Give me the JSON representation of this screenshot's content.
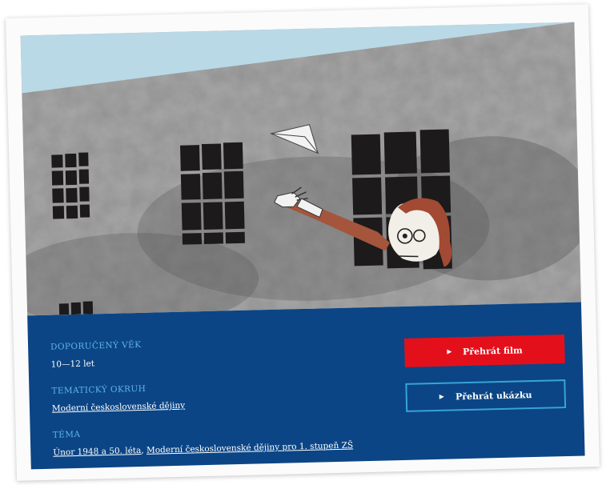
{
  "meta": {
    "age_label": "DOPORUČENÝ VĚK",
    "age_value": "10—12 let",
    "topic_label": "TEMATICKÝ OKRUH",
    "topic_value": "Moderní československé dějiny",
    "theme_label": "TÉMA",
    "theme_link_1": "Únor 1948 a 50. léta",
    "theme_separator": ",",
    "theme_link_2": "Moderní československé dějiny pro 1. stupeň ZŠ"
  },
  "actions": {
    "play_film": "Přehrát film",
    "play_sample": "Přehrát ukázku"
  },
  "colors": {
    "panel": "#0b4585",
    "label": "#5fb4e6",
    "primary_button": "#e3101c",
    "secondary_border": "#37a3d9"
  },
  "icons": {
    "play": "play-icon",
    "paper_plane": "paper-plane-icon"
  }
}
